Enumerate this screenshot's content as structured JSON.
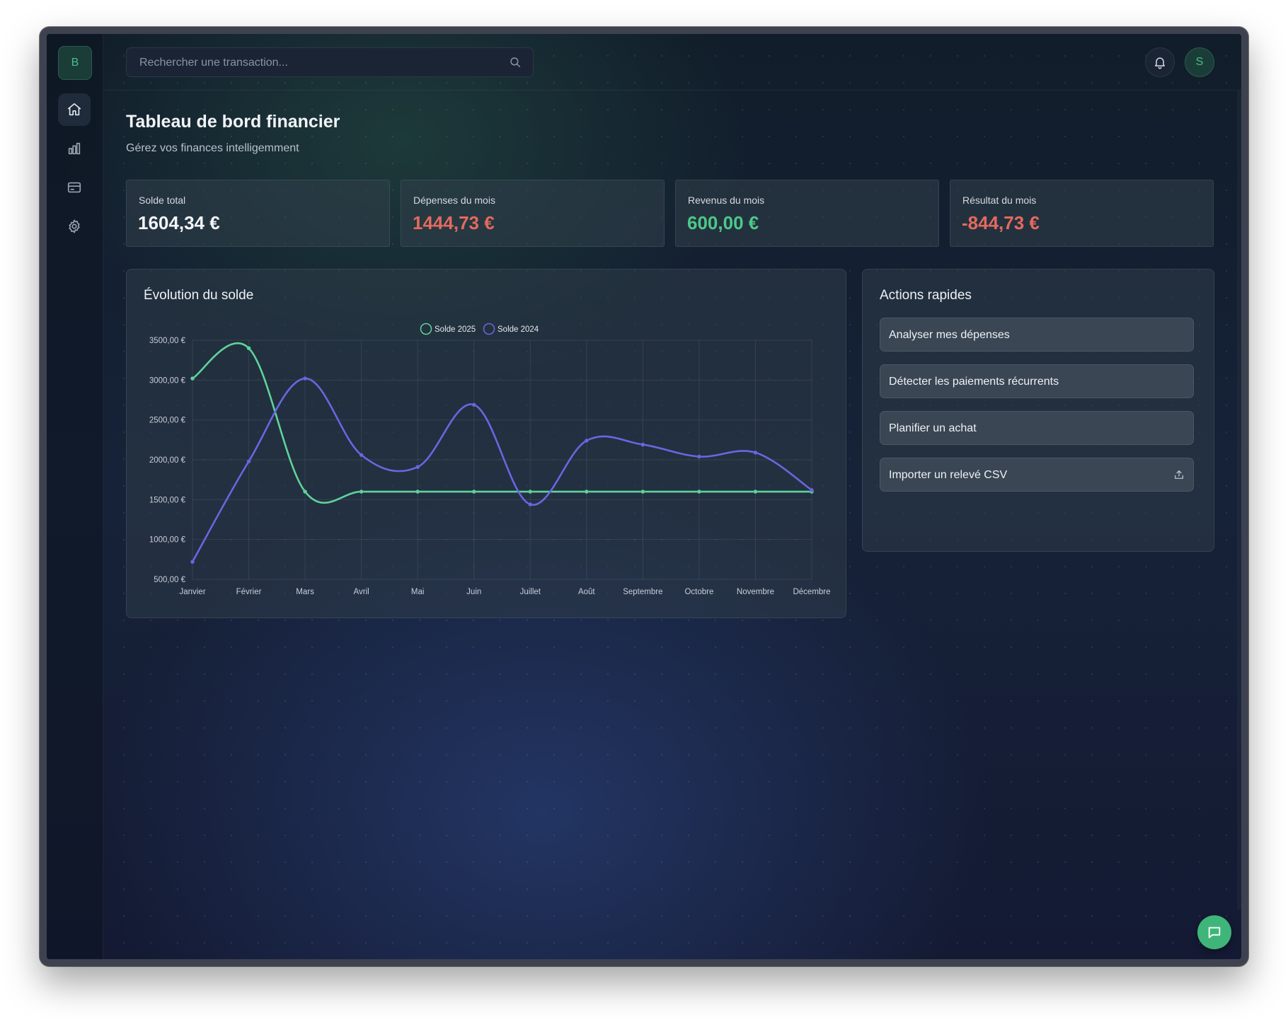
{
  "sidebar": {
    "logo_letter": "B",
    "items": [
      {
        "name": "home-icon",
        "active": true
      },
      {
        "name": "bar-chart-icon",
        "active": false
      },
      {
        "name": "credit-card-icon",
        "active": false
      },
      {
        "name": "gear-icon",
        "active": false
      }
    ]
  },
  "topbar": {
    "search_placeholder": "Rechercher une transaction...",
    "avatar_letter": "S"
  },
  "header": {
    "title": "Tableau de bord financier",
    "subtitle": "Gérez vos finances intelligemment"
  },
  "stats": [
    {
      "label": "Solde total",
      "value": "1604,34 €",
      "color": "#f2f4f8"
    },
    {
      "label": "Dépenses du mois",
      "value": "1444,73 €",
      "color": "#e5695e"
    },
    {
      "label": "Revenus du mois",
      "value": "600,00 €",
      "color": "#4cc98a"
    },
    {
      "label": "Résultat du mois",
      "value": "-844,73 €",
      "color": "#e5695e"
    }
  ],
  "chart_card": {
    "title": "Évolution du solde"
  },
  "actions": {
    "title": "Actions rapides",
    "items": [
      {
        "label": "Analyser mes dépenses"
      },
      {
        "label": "Détecter les paiements récurrents"
      },
      {
        "label": "Planifier un achat"
      },
      {
        "label": "Importer un relevé CSV",
        "icon": "upload-icon"
      }
    ]
  },
  "colors": {
    "accent_green": "#4cc98a",
    "accent_purple": "#6a66e0",
    "negative_red": "#e5695e"
  },
  "chart_data": {
    "type": "line",
    "categories": [
      "Janvier",
      "Février",
      "Mars",
      "Avril",
      "Mai",
      "Juin",
      "Juillet",
      "Août",
      "Septembre",
      "Octobre",
      "Novembre",
      "Décembre"
    ],
    "series": [
      {
        "name": "Solde 2025",
        "color": "#5fd39a",
        "values": [
          3020,
          3400,
          1600,
          1600,
          1600,
          1600,
          1600,
          1600,
          1600,
          1600,
          1600,
          1600
        ]
      },
      {
        "name": "Solde 2024",
        "color": "#6a66e0",
        "values": [
          720,
          1980,
          3020,
          2060,
          1910,
          2690,
          1440,
          2240,
          2190,
          2040,
          2090,
          1620
        ]
      }
    ],
    "y_ticks": [
      "3500,00 €",
      "3000,00 €",
      "2500,00 €",
      "2000,00 €",
      "1500,00 €",
      "1000,00 €",
      "500,00 €"
    ],
    "ylim": [
      500,
      3500
    ],
    "grid": true,
    "legend_position": "top-center",
    "smooth": true
  }
}
